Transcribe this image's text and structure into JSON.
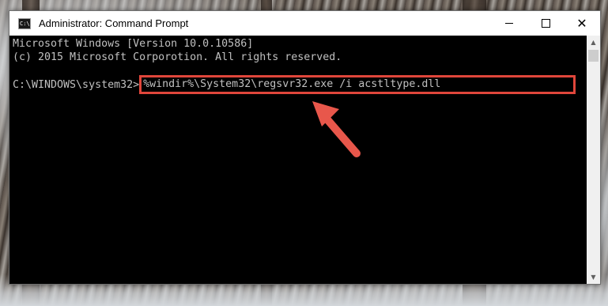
{
  "window": {
    "title": "Administrator: Command Prompt",
    "icon_label": "C:\\",
    "controls": {
      "minimize": "minimize-icon",
      "maximize": "maximize-icon",
      "close": "close-icon"
    }
  },
  "console": {
    "line1": "Microsoft Windows [Version 10.0.10586]",
    "line2": "(c) 2015 Microsoft Corporotion. All rights reserved.",
    "prompt": "C:\\WINDOWS\\system32>",
    "command": "%windir%\\System32\\regsvr32.exe /i acstltype.dll"
  },
  "scrollbar": {
    "up_arrow": "▲",
    "down_arrow": "▼"
  },
  "annotation": {
    "highlight_color": "#e0463b",
    "arrow_color": "#e8574b"
  }
}
